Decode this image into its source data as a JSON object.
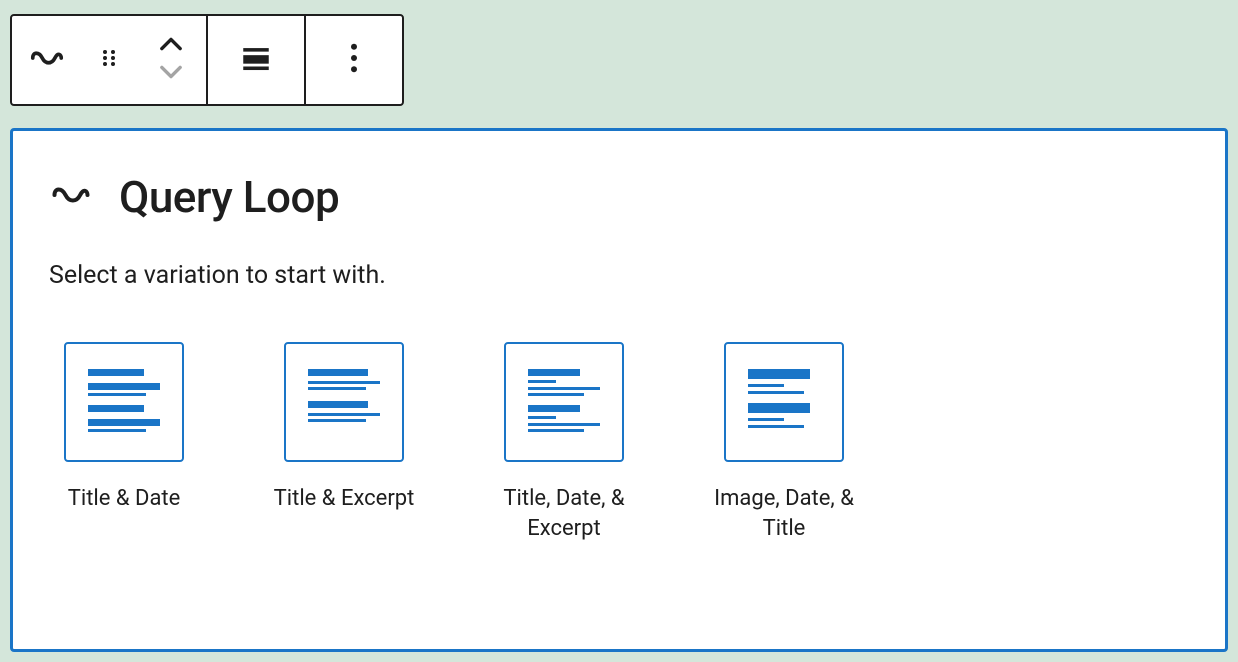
{
  "toolbar": {
    "icons": {
      "block_type": "query-loop-icon",
      "drag": "drag-handle-icon",
      "move_up": "chevron-up-icon",
      "move_down": "chevron-down-icon",
      "align": "align-icon",
      "options": "more-options-icon"
    }
  },
  "placeholder": {
    "icon": "query-loop-icon",
    "title": "Query Loop",
    "instructions": "Select a variation to start with.",
    "variations": [
      {
        "name": "title-date",
        "label": "Title & Date"
      },
      {
        "name": "title-excerpt",
        "label": "Title & Excerpt"
      },
      {
        "name": "title-date-excerpt",
        "label": "Title, Date, & Excerpt"
      },
      {
        "name": "image-date-title",
        "label": "Image, Date, & Title"
      }
    ]
  },
  "colors": {
    "accent": "#1a75c7",
    "text": "#1e1e1e",
    "bg": "#d4e6da",
    "muted": "#b9bcbf"
  }
}
